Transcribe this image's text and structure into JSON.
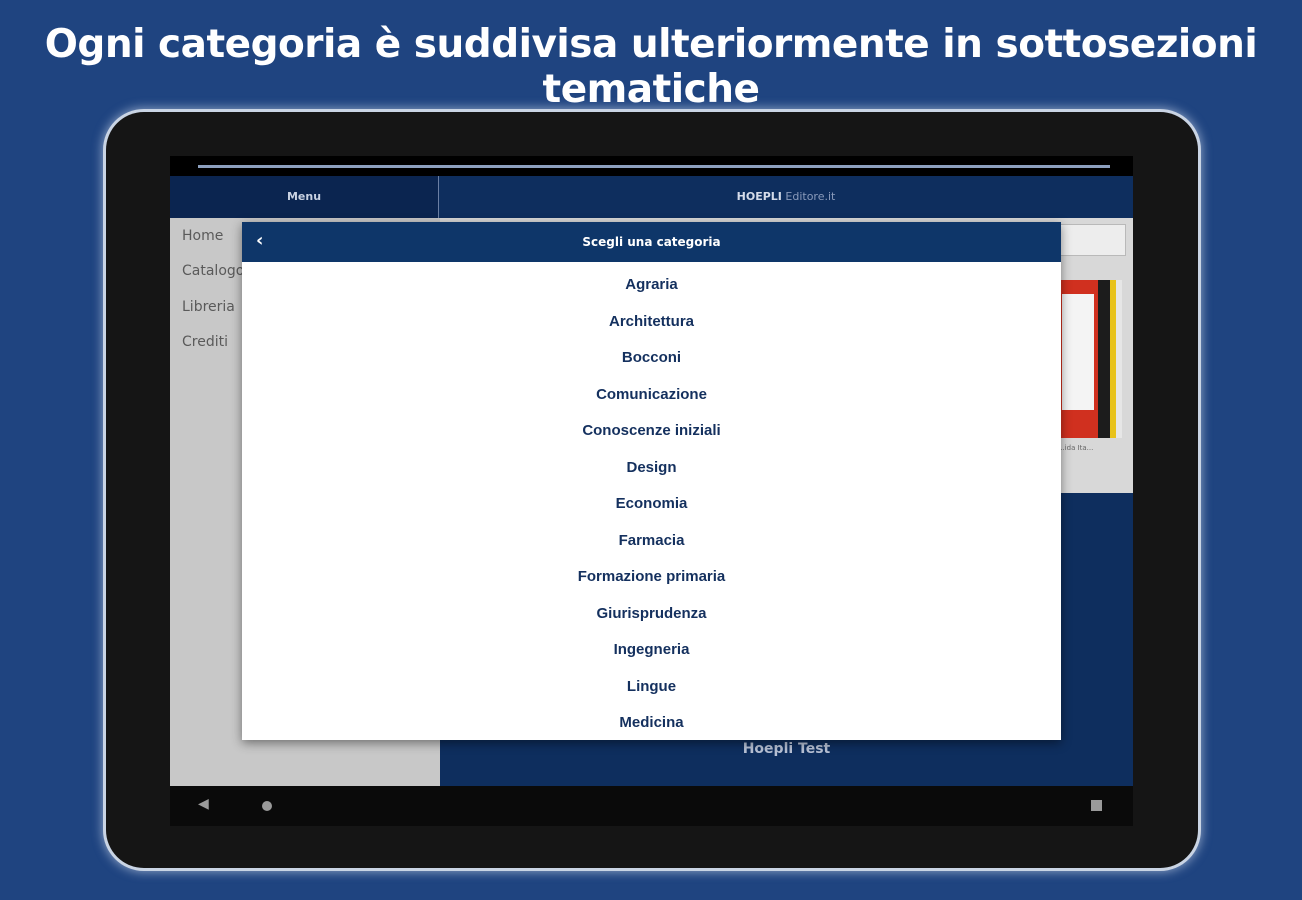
{
  "headline": "Ogni categoria è suddivisa ulteriormente in sottosezioni tematiche",
  "appbar": {
    "menu_label": "Menu",
    "brand_bold": "HOEPLI",
    "brand_light": "Editore.it"
  },
  "drawer": {
    "items": [
      {
        "label": "Home"
      },
      {
        "label": "Catalogo"
      },
      {
        "label": "Libreria"
      },
      {
        "label": "Crediti"
      }
    ]
  },
  "content": {
    "book_caption": "...ida Ita...",
    "app_title": "Hoepli Test"
  },
  "modal": {
    "title": "Scegli una categoria",
    "categories": [
      "Agraria",
      "Architettura",
      "Bocconi",
      "Comunicazione",
      "Conoscenze iniziali",
      "Design",
      "Economia",
      "Farmacia",
      "Formazione primaria",
      "Giurisprudenza",
      "Ingegneria",
      "Lingue",
      "Medicina"
    ]
  },
  "navbar": {
    "back_icon": "triangle-left",
    "home_icon": "circle",
    "recent_icon": "square"
  },
  "colors": {
    "background": "#1f4480",
    "header_blue": "#0e3669",
    "category_text": "#14305e"
  }
}
